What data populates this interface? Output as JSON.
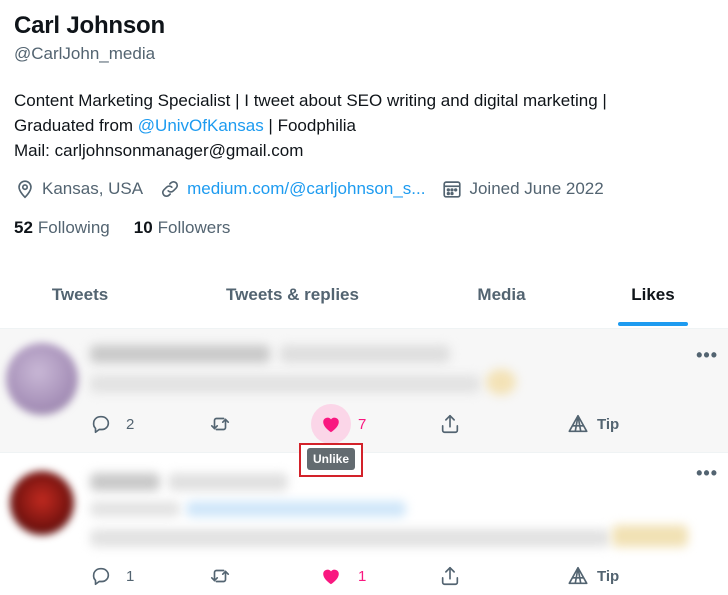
{
  "profile": {
    "name": "Carl Johnson",
    "handle": "@CarlJohn_media",
    "bio_line1": "Content Marketing Specialist | I tweet about SEO writing and digital marketing |",
    "bio_line2_prefix": "Graduated from ",
    "bio_line2_mention": "@UnivOfKansas",
    "bio_line2_suffix": " | Foodphilia",
    "bio_line3": "Mail: carljohnsonmanager@gmail.com",
    "location": "Kansas, USA",
    "website": "medium.com/@carljohnson_s...",
    "joined": "Joined June 2022",
    "following_count": "52",
    "following_label": "Following",
    "followers_count": "10",
    "followers_label": "Followers"
  },
  "tabs": [
    {
      "label": "Tweets"
    },
    {
      "label": "Tweets & replies"
    },
    {
      "label": "Media"
    },
    {
      "label": "Likes"
    }
  ],
  "tweets": [
    {
      "reply_count": "2",
      "like_count": "7",
      "tip_label": "Tip",
      "more": "•••"
    },
    {
      "reply_count": "1",
      "like_count": "1",
      "tip_label": "Tip",
      "more": "•••"
    }
  ],
  "tooltip": {
    "label": "Unlike"
  },
  "colors": {
    "accent": "#1d9bf0",
    "like": "#f91880",
    "highlight_box": "#d3222a"
  }
}
